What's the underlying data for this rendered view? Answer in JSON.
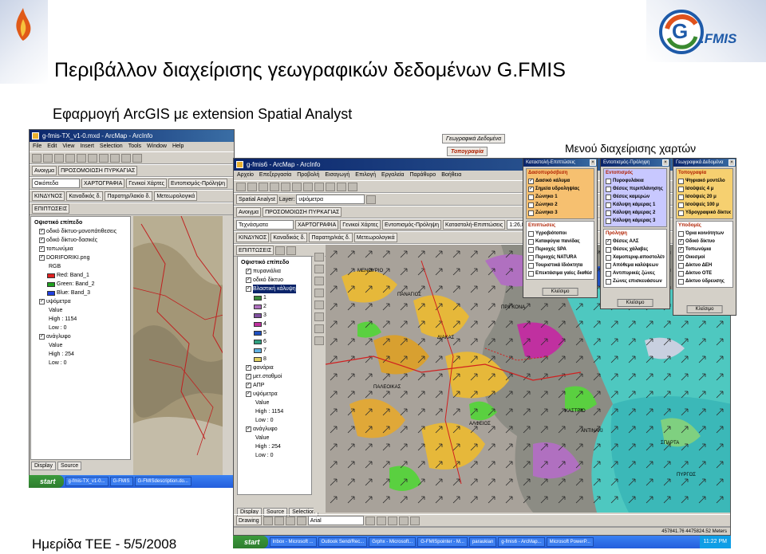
{
  "slide": {
    "title": "Περιβάλλον διαχείρισης γεωγραφικών δεδομένων G.FMIS",
    "subtitle": "Εφαρμογή ArcGIS με extension Spatial Analyst",
    "footer": "Ημερίδα ΤΕΕ - 5/5/2008",
    "menus_label": "Μενού διαχείρισης χαρτών",
    "logo_text": "G.FMIS"
  },
  "back_window": {
    "title": "g-fmis-TX_v1-0.mxd - ArcMap - ArcInfo",
    "menus": [
      "File",
      "Edit",
      "View",
      "Insert",
      "Selection",
      "Tools",
      "Window",
      "Help"
    ],
    "tool_items": [
      "Ανοιγμα",
      "ΠΡΟΣΟΜΟΙΩΣΗ ΠΥΡΚΑΓΙΑΣ",
      "ΧΑΡΤΟΓΡΑΦΙΑ",
      "Γενικοί Χάρτες",
      "Εντοπισμός-Πρόληψη"
    ],
    "combo": "Οικόπεδα",
    "row3": [
      "ΚΙΝΔΥΝΟΣ",
      "Καναδικός δ.",
      "Παρατηρ/λακίο δ.",
      "Μετεωρολογικά"
    ],
    "row4": "ΕΠΙΠΤΩΣΕΙΣ",
    "toc": [
      {
        "t": "Οψιστικό επίπεδο",
        "k": "hdr"
      },
      {
        "t": "οδικό δίκτυο-μονοπάτιθεσεις",
        "k": "chk"
      },
      {
        "t": "οδικό δίκτυο-δασικές",
        "k": "chk"
      },
      {
        "t": "τοπωνύμια",
        "k": "chk"
      },
      {
        "t": "DORIFORIKI.png",
        "k": "chk"
      },
      {
        "t": "RGB",
        "k": "sub"
      },
      {
        "t": "Red: Band_1",
        "k": "red"
      },
      {
        "t": "Green: Band_2",
        "k": "green"
      },
      {
        "t": "Blue: Band_3",
        "k": "blue"
      },
      {
        "t": "υψόμετρα",
        "k": "chk"
      },
      {
        "t": "Value",
        "k": "sub"
      },
      {
        "t": "High : 1154",
        "k": "sub"
      },
      {
        "t": "Low : 0",
        "k": "sub"
      },
      {
        "t": "ανάγλυφο",
        "k": "chk"
      },
      {
        "t": "Value",
        "k": "sub"
      },
      {
        "t": "High : 254",
        "k": "sub"
      },
      {
        "t": "Low : 0",
        "k": "sub"
      }
    ],
    "tabs": [
      "Display",
      "Source"
    ]
  },
  "back_taskbar": {
    "start": "start",
    "tasks": [
      "g-fmis-TX_v1-0...",
      "G-FMIS",
      "G-FMISdescription.do..."
    ]
  },
  "front_window": {
    "title": "g-fmis6 - ArcMap - ArcInfo",
    "menus": [
      "Αρχείο",
      "Επεξεργασία",
      "Προβολή",
      "Εισαγωγή",
      "Επιλογή",
      "Εργαλεία",
      "Παράθυρο",
      "Βοήθεια"
    ],
    "spatial": "Spatial Analyst",
    "layer_label": "Layer:",
    "layer_value": "υψόμετρα",
    "row3": [
      "Ανοιγμα",
      "ΠΡΟΣΟΜΟΙΩΣΗ ΠΥΡΚΑΓΙΑΣ"
    ],
    "row4_combo": "Τεχνάσματα",
    "row4": [
      "ΧΑΡΤΟΓΡΑΦΙΑ",
      "Γενικοί Χάρτες",
      "Εντοπισμός-Πρόληψη",
      "Καταστολή-Επιπτώσεις"
    ],
    "scale": "1:26,82",
    "row5": [
      "ΚΙΝΔΥΝΟΣ",
      "Καναδικός δ.",
      "Παρατηρ/κάς δ.",
      "Μετεωρολογικά"
    ],
    "row6": "ΕΠΙΠΤΩΣΕΙΣ",
    "toc": [
      {
        "t": "Οψιστικό επίπεδο",
        "k": "hdr"
      },
      {
        "t": "πυρανιάλια",
        "k": "chk"
      },
      {
        "t": "οδικό δίκτυο",
        "k": "chk"
      },
      {
        "t": "Βλαστική κάλυψη",
        "k": "sel"
      },
      {
        "t": "1",
        "c": "#3a8a3a"
      },
      {
        "t": "2",
        "c": "#b070c0"
      },
      {
        "t": "3",
        "c": "#8050a0"
      },
      {
        "t": "4",
        "c": "#c030a0"
      },
      {
        "t": "5",
        "c": "#2050c0"
      },
      {
        "t": "6",
        "c": "#30a080"
      },
      {
        "t": "7",
        "c": "#60b0e0"
      },
      {
        "t": "8",
        "c": "#e0d060"
      },
      {
        "t": "φανάρια",
        "k": "chk"
      },
      {
        "t": "μετ.σταθμοί",
        "k": "chk"
      },
      {
        "t": "ΑΠΡ",
        "k": "chk"
      },
      {
        "t": "υψόμετρα",
        "k": "chk"
      },
      {
        "t": "Value",
        "k": "sub"
      },
      {
        "t": "High : 1154",
        "k": "sub"
      },
      {
        "t": "Low : 0",
        "k": "sub"
      },
      {
        "t": "ανάγλυφο",
        "k": "chk"
      },
      {
        "t": "Value",
        "k": "sub"
      },
      {
        "t": "High : 254",
        "k": "sub"
      },
      {
        "t": "Low : 0",
        "k": "sub"
      }
    ],
    "tabs": [
      "Display",
      "Source",
      "Selection"
    ],
    "drawing": "Drawing",
    "font": "Arial",
    "status": "457841.76  4475824.52 Meters"
  },
  "front_taskbar": {
    "start": "start",
    "tasks": [
      "Inbox - Microsoft ...",
      "Outlook Send/Rec...",
      "Grphx - Microsoft...",
      "G-FMISpointer - M...",
      "paraukian",
      "g-fmis6 - ArcMap...",
      "Microsoft PowerP..."
    ],
    "clock": "11:22 PM"
  },
  "map_labels": [
    "ΜΕΝΟΥΡΙΟ",
    "ΠΑΝΑΓΙΟΣ",
    "ΔΙΑΚΑΣ",
    "ΠΑΛΕΟΙΚΑΣ",
    "ΑΛΦΕΙΟΣ",
    "ΠΡΙΓΚΟΝΑ",
    "ΚΑΣΤΡΙΟ",
    "ΑΝΤΙΝΑΚΙ",
    "ΣΠΑΡΤΑ",
    "ΠΥΡΓΟΣ"
  ],
  "panels": [
    {
      "title": "Καταστολή-Επιπτώσεις",
      "top_tab": "Τοπογραφία",
      "groups": [
        {
          "h": "Δασοπυρόσβεση",
          "items": [
            {
              "t": "Δασικό κάλυμα",
              "c": true
            },
            {
              "t": "Σημεία υδροληψίας",
              "c": true
            },
            {
              "t": "Ζώνηκο 1",
              "c": false
            },
            {
              "t": "Ζώνηκο 2",
              "c": false
            },
            {
              "t": "Ζώνηκο 3",
              "c": false
            }
          ]
        },
        {
          "h": "Επιπτώσεις",
          "items": [
            {
              "t": "Υγροβιότοποι",
              "c": false
            },
            {
              "t": "Καταφύγια πανίδας",
              "c": false
            },
            {
              "t": "Περιοχές SPA",
              "c": false
            },
            {
              "t": "Περιοχές NATURA",
              "c": false
            },
            {
              "t": "Τουριστικά Ιδιόκτητα",
              "c": false
            },
            {
              "t": "Επεκτάσιμα γαίες διαθέσεως",
              "c": false
            }
          ]
        }
      ],
      "close": "Κλείσιμο"
    },
    {
      "title": "Εντοπισμός-Πρόληψη",
      "groups": [
        {
          "h": "Εντοπισμός",
          "items": [
            {
              "t": "Πυροφυλάκια",
              "c": false
            },
            {
              "t": "Θέσεις περιπλάνησης",
              "c": false
            },
            {
              "t": "Θέσεις καμερών",
              "c": false
            },
            {
              "t": "Κάλυψη κάμερας 1",
              "c": false
            },
            {
              "t": "Κάλυψη κάμερας 2",
              "c": false
            },
            {
              "t": "Κάλυψη κάμερας 3",
              "c": false
            }
          ]
        },
        {
          "h": "Πρόληψη",
          "items": [
            {
              "t": "Θέσεις ΑΛΣ",
              "c": true
            },
            {
              "t": "Θέσεις χάλαβες",
              "c": false
            },
            {
              "t": "Χαμοπεριφ.αποστολέτον",
              "c": false
            },
            {
              "t": "Απόθεμα καλύψεων",
              "c": false
            },
            {
              "t": "Αντιπυρικές ζώνες",
              "c": false
            },
            {
              "t": "Ζώνες επισκευάσεων",
              "c": false
            }
          ]
        }
      ],
      "close": "Κλείσιμο"
    },
    {
      "title": "Γεωγραφικά Δεδομένα",
      "groups": [
        {
          "h": "Τοπογραφία",
          "items": [
            {
              "t": "Ψηφιακό μοντέλο",
              "c": false
            },
            {
              "t": "Ισοϋψείς 4 μ",
              "c": false
            },
            {
              "t": "Ισοϋψείς 20 μ",
              "c": false
            },
            {
              "t": "Ισοϋψείς 100 μ",
              "c": false
            },
            {
              "t": "Υδρογραφικό δίκτυο",
              "c": false
            }
          ]
        },
        {
          "h": "Υποδομές",
          "items": [
            {
              "t": "Όρια κοινότητων",
              "c": false
            },
            {
              "t": "Οδικό δίκτυο",
              "c": true
            },
            {
              "t": "Τοπωνύμια",
              "c": true
            },
            {
              "t": "Οικισμοί",
              "c": true
            },
            {
              "t": "Δίκτυο ΔΕΗ",
              "c": false
            },
            {
              "t": "Δίκτυο ΟΤΕ",
              "c": false
            },
            {
              "t": "Δίκτυο ύδρευσης",
              "c": false
            }
          ]
        }
      ],
      "close": "Κλείσιμο"
    }
  ],
  "panel_header_tabs": [
    "Γεωγραφικά Δεδομένα",
    "Τοπογραφία"
  ],
  "colors": {
    "titlebar": "#0a246a",
    "panel_groupA": "#f6c070",
    "panel_groupB": "#c8c8ff",
    "panel_groupC": "#f6d070"
  }
}
